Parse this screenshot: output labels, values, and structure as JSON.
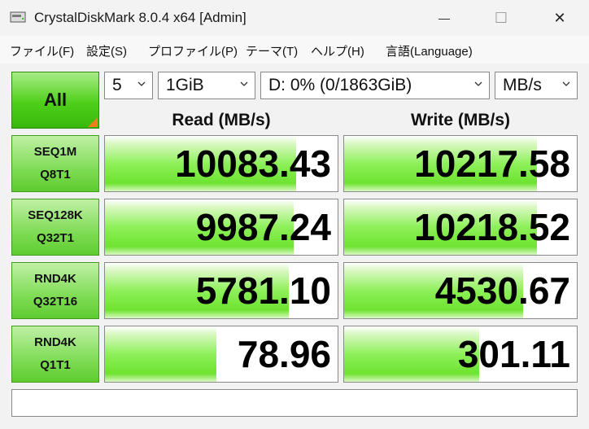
{
  "window": {
    "title": "CrystalDiskMark 8.0.4 x64 [Admin]",
    "minimize_glyph": "—",
    "maximize_glyph": "☐",
    "close_glyph": "✕"
  },
  "menu": [
    "ファイル(F)",
    "設定(S)",
    "プロファイル(P)",
    "テーマ(T)",
    "ヘルプ(H)",
    "言語(Language)"
  ],
  "controls": {
    "all_label": "All",
    "count": "5",
    "size": "1GiB",
    "drive": "D: 0% (0/1863GiB)",
    "unit": "MB/s"
  },
  "headers": {
    "read": "Read (MB/s)",
    "write": "Write (MB/s)"
  },
  "tests": [
    {
      "line1": "SEQ1M",
      "line2": "Q8T1",
      "read": "10083.43",
      "write": "10217.58",
      "read_level": 0.82,
      "write_level": 0.83
    },
    {
      "line1": "SEQ128K",
      "line2": "Q32T1",
      "read": "9987.24",
      "write": "10218.52",
      "read_level": 0.81,
      "write_level": 0.83
    },
    {
      "line1": "RND4K",
      "line2": "Q32T16",
      "read": "5781.10",
      "write": "4530.67",
      "read_level": 0.79,
      "write_level": 0.77
    },
    {
      "line1": "RND4K",
      "line2": "Q1T1",
      "read": "78.96",
      "write": "301.11",
      "read_level": 0.48,
      "write_level": 0.58
    }
  ],
  "comment": "",
  "colors": {
    "bar_green": "#6ee330",
    "button_green": "#4ed01a",
    "corner_orange": "#f07d1a"
  }
}
